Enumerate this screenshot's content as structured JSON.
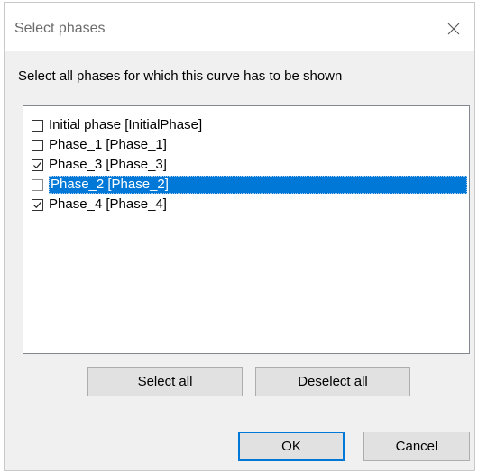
{
  "dialog": {
    "title": "Select phases",
    "close_icon": "close-icon",
    "instruction": "Select all phases for which this curve has to be shown"
  },
  "phases": [
    {
      "label": "Initial phase [InitialPhase]",
      "checked": false,
      "selected": false
    },
    {
      "label": "Phase_1 [Phase_1]",
      "checked": false,
      "selected": false
    },
    {
      "label": "Phase_3 [Phase_3]",
      "checked": true,
      "selected": false
    },
    {
      "label": "Phase_2 [Phase_2]",
      "checked": false,
      "selected": true
    },
    {
      "label": "Phase_4 [Phase_4]",
      "checked": true,
      "selected": false
    }
  ],
  "buttons": {
    "select_all": "Select all",
    "deselect_all": "Deselect all",
    "ok": "OK",
    "cancel": "Cancel"
  },
  "colors": {
    "selection": "#0078d7",
    "dialog_bg": "#f0f0f0"
  }
}
